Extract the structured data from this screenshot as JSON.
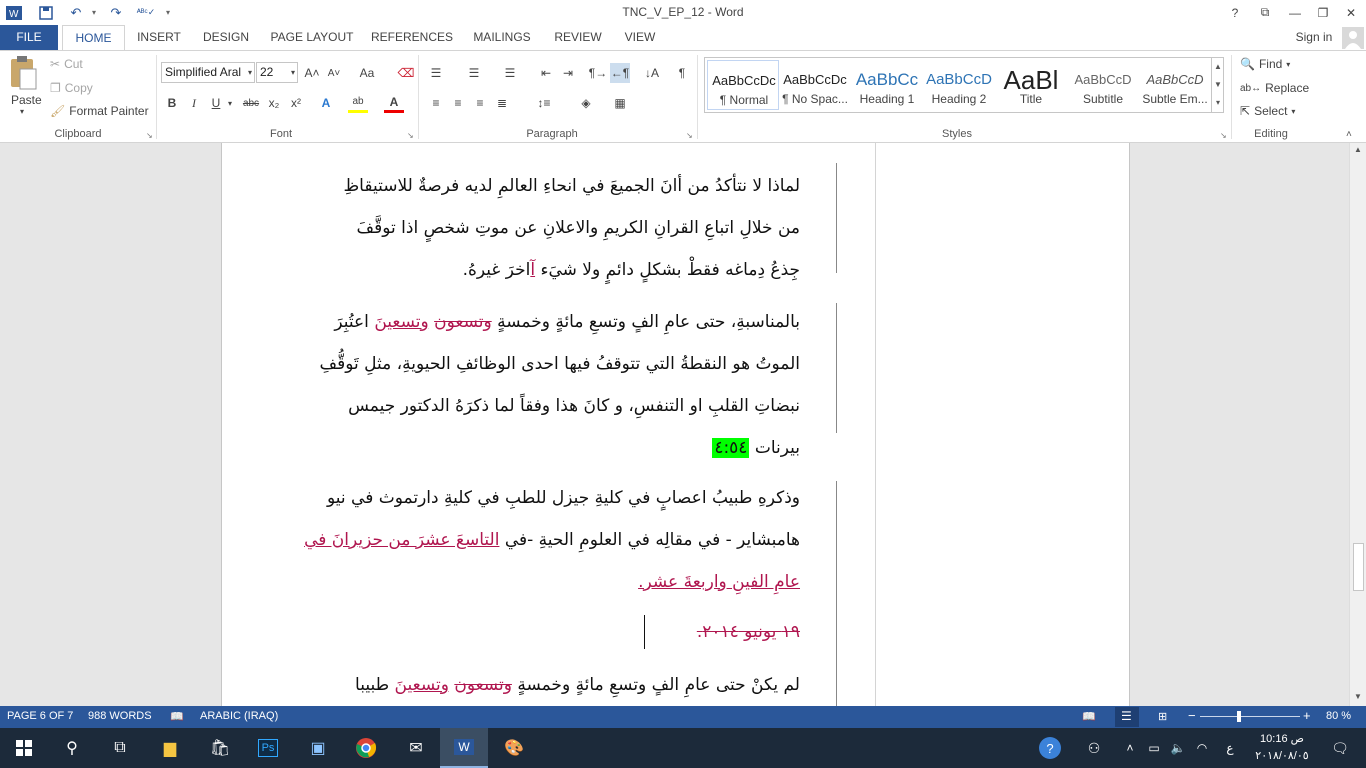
{
  "window": {
    "title": "TNC_V_EP_12 - Word",
    "help": "?",
    "restore_ribbon": "⧉",
    "minimize": "—",
    "maximize": "❐",
    "close": "✕"
  },
  "tabs": [
    {
      "label": "FILE"
    },
    {
      "label": "HOME"
    },
    {
      "label": "INSERT"
    },
    {
      "label": "DESIGN"
    },
    {
      "label": "PAGE LAYOUT"
    },
    {
      "label": "REFERENCES"
    },
    {
      "label": "MAILINGS"
    },
    {
      "label": "REVIEW"
    },
    {
      "label": "VIEW"
    }
  ],
  "signin": "Sign in",
  "clipboard": {
    "paste": "Paste",
    "cut": "Cut",
    "copy": "Copy",
    "format_painter": "Format Painter",
    "label": "Clipboard"
  },
  "font": {
    "name": "Simplified Aral",
    "size": "22",
    "label": "Font",
    "bold": "B",
    "italic": "I",
    "underline": "U",
    "strike": "abc",
    "sub": "x₂",
    "sup": "x²",
    "grow": "A˄",
    "shrink": "A˅",
    "case": "Aa",
    "text_effects": "A",
    "highlight": "ab",
    "font_color": "A"
  },
  "paragraph": {
    "label": "Paragraph",
    "pilcrow": "¶"
  },
  "styles": {
    "label": "Styles",
    "items": [
      {
        "sample": "AaBbCcDc",
        "name": "¶ Normal"
      },
      {
        "sample": "AaBbCcDc",
        "name": "¶ No Spac..."
      },
      {
        "sample": "AaBbCc",
        "name": "Heading 1"
      },
      {
        "sample": "AaBbCcD",
        "name": "Heading 2"
      },
      {
        "sample": "AaBl",
        "name": "Title"
      },
      {
        "sample": "AaBbCcD",
        "name": "Subtitle"
      },
      {
        "sample": "AaBbCcD",
        "name": "Subtle Em..."
      }
    ]
  },
  "editing": {
    "label": "Editing",
    "find": "Find",
    "replace": "Replace",
    "select": "Select"
  },
  "document": {
    "p1": {
      "l1": "لماذا لا نتأكدُ من أانَ الجميعَ في انحاءِ العالمِ لديه فرصةٌ للاستيقاظِ",
      "l2": "من خلالِ اتباعِ القرانِ الكريمِ والاعلانِ عن موتِ شخصٍ اذا توقَّفَ",
      "l3a": "جِذعُ دِماغه فقطْ بشكلٍ دائمٍ ولا شيَء ",
      "l3b": "آ",
      "l3c": "اخرَ غيرهُ."
    },
    "p2": {
      "l1a": "بالمناسبةِ، حتى عامِ الفٍ وتسعِ مائةٍ و",
      "l1b": "خمسةٍ",
      "l1c": "وتسعون",
      "l1d": "وتسعينَ",
      "l1e": " اعتُبِرَ",
      "l2": "الموتُ هو النقطةُ التي تتوقفُ فيها احدى الوظائفِ الحيويةِ، مثلِ تَوقُّفِ",
      "l3": "نبضاتِ القلبِ او التنفسِ، و كانَ هذا وفقاً لما ذكرَهُ الدكتور جيمس",
      "l4a": "بيرنات ",
      "timestamp": "٤:٥٤"
    },
    "p3": {
      "l1": "وذكرهِ طبيبُ اعصابٍ في كليةِ جيزل للطبِ في كليةِ دارتموث في نيو",
      "l2a": "هامبشاير - في مقالِه في العلومِ الحيةِ -في ",
      "l2b": "التاسعَ عشرَ من حزيرانَ في",
      "l3": "عامِ الفينِ واربعةَ عشر."
    },
    "deleted_date": "١٩ يونيو ٢٠١٤.",
    "p4": {
      "l1a": "لم يكنْ حتى عامِ الفٍ وتسعِ مائةٍ و",
      "l1b": "خمسةٍ",
      "l1c": "وتسعون",
      "l1d": "وتسعينَ",
      "l1e": " طبيبا"
    }
  },
  "status": {
    "page": "PAGE 6 OF 7",
    "words": "988 WORDS",
    "language": "ARABIC (IRAQ)",
    "zoom": "80 %",
    "zoom_minus": "−",
    "zoom_plus": "+"
  },
  "taskbar": {
    "time": "10:16 ص",
    "date": "٢٠١٨/٠٨/٠٥",
    "ime": "ع"
  },
  "colors": {
    "accent": "#2b579a",
    "revision": "#b0164f",
    "highlight": "#00ff00"
  }
}
